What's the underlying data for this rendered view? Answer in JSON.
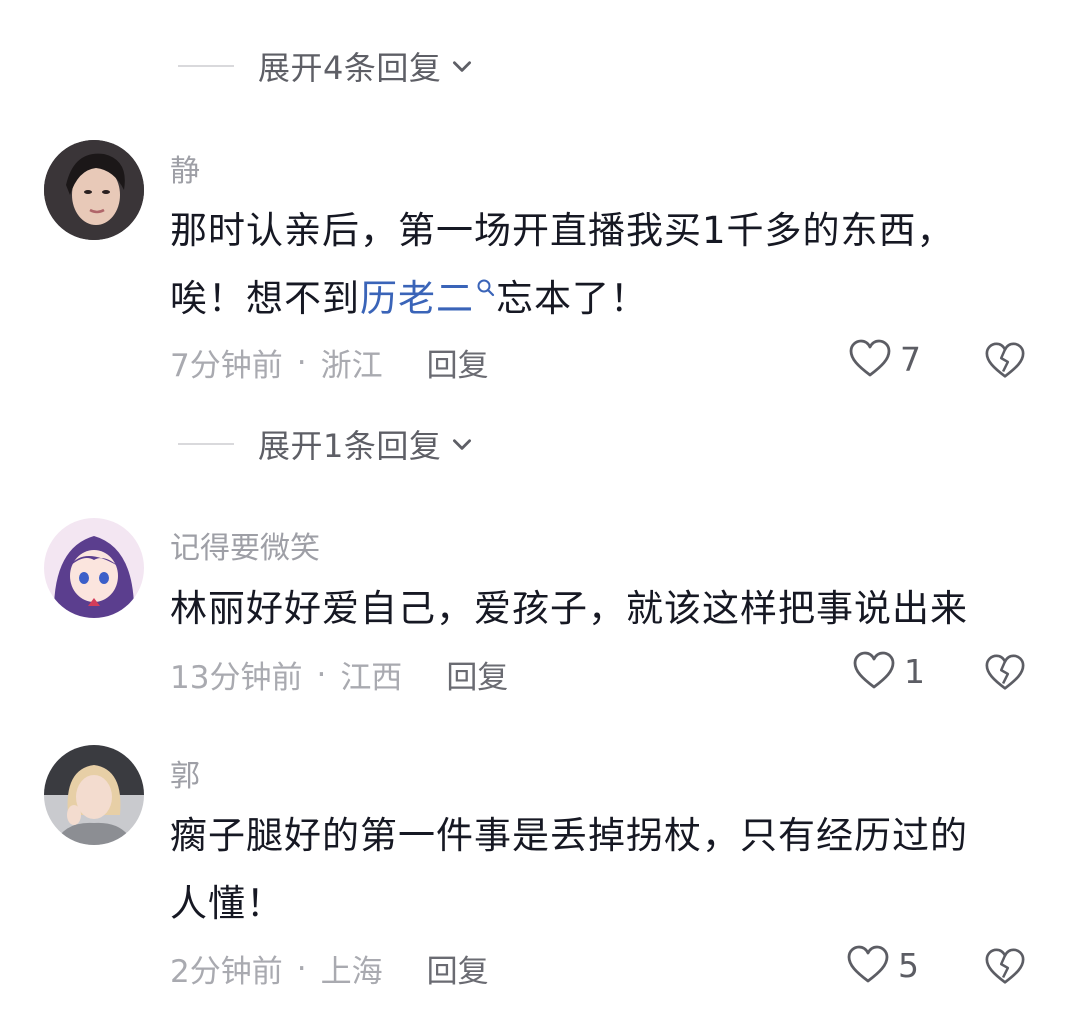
{
  "expand1": {
    "label": "展开4条回复"
  },
  "expand2": {
    "label": "展开1条回复"
  },
  "comments": [
    {
      "username": "静",
      "content_parts": [
        "那时认亲后，第一场开直播我买1千多的东西，",
        "唉！想不到",
        "历老二",
        "忘本了！"
      ],
      "time": "7分钟前",
      "location": "浙江",
      "reply": "回复",
      "likes": "7"
    },
    {
      "username": "记得要微笑",
      "content_parts": [
        "林丽好好爱自己，爱孩子，就该这样把事说出来"
      ],
      "time": "13分钟前",
      "location": "江西",
      "reply": "回复",
      "likes": "1"
    },
    {
      "username": "郭",
      "content_parts": [
        "瘸子腿好的第一件事是丢掉拐杖，只有经历过的",
        "人懂！"
      ],
      "time": "2分钟前",
      "location": "上海",
      "reply": "回复",
      "likes": "5"
    }
  ],
  "separator": "·",
  "colors": {
    "mention": "#3a64b8",
    "meta": "#a9aab0",
    "text": "#161823"
  },
  "icons": {
    "like": "heart-outline-icon",
    "dislike": "broken-heart-icon",
    "expand": "chevron-down-icon",
    "mention": "search-icon"
  }
}
